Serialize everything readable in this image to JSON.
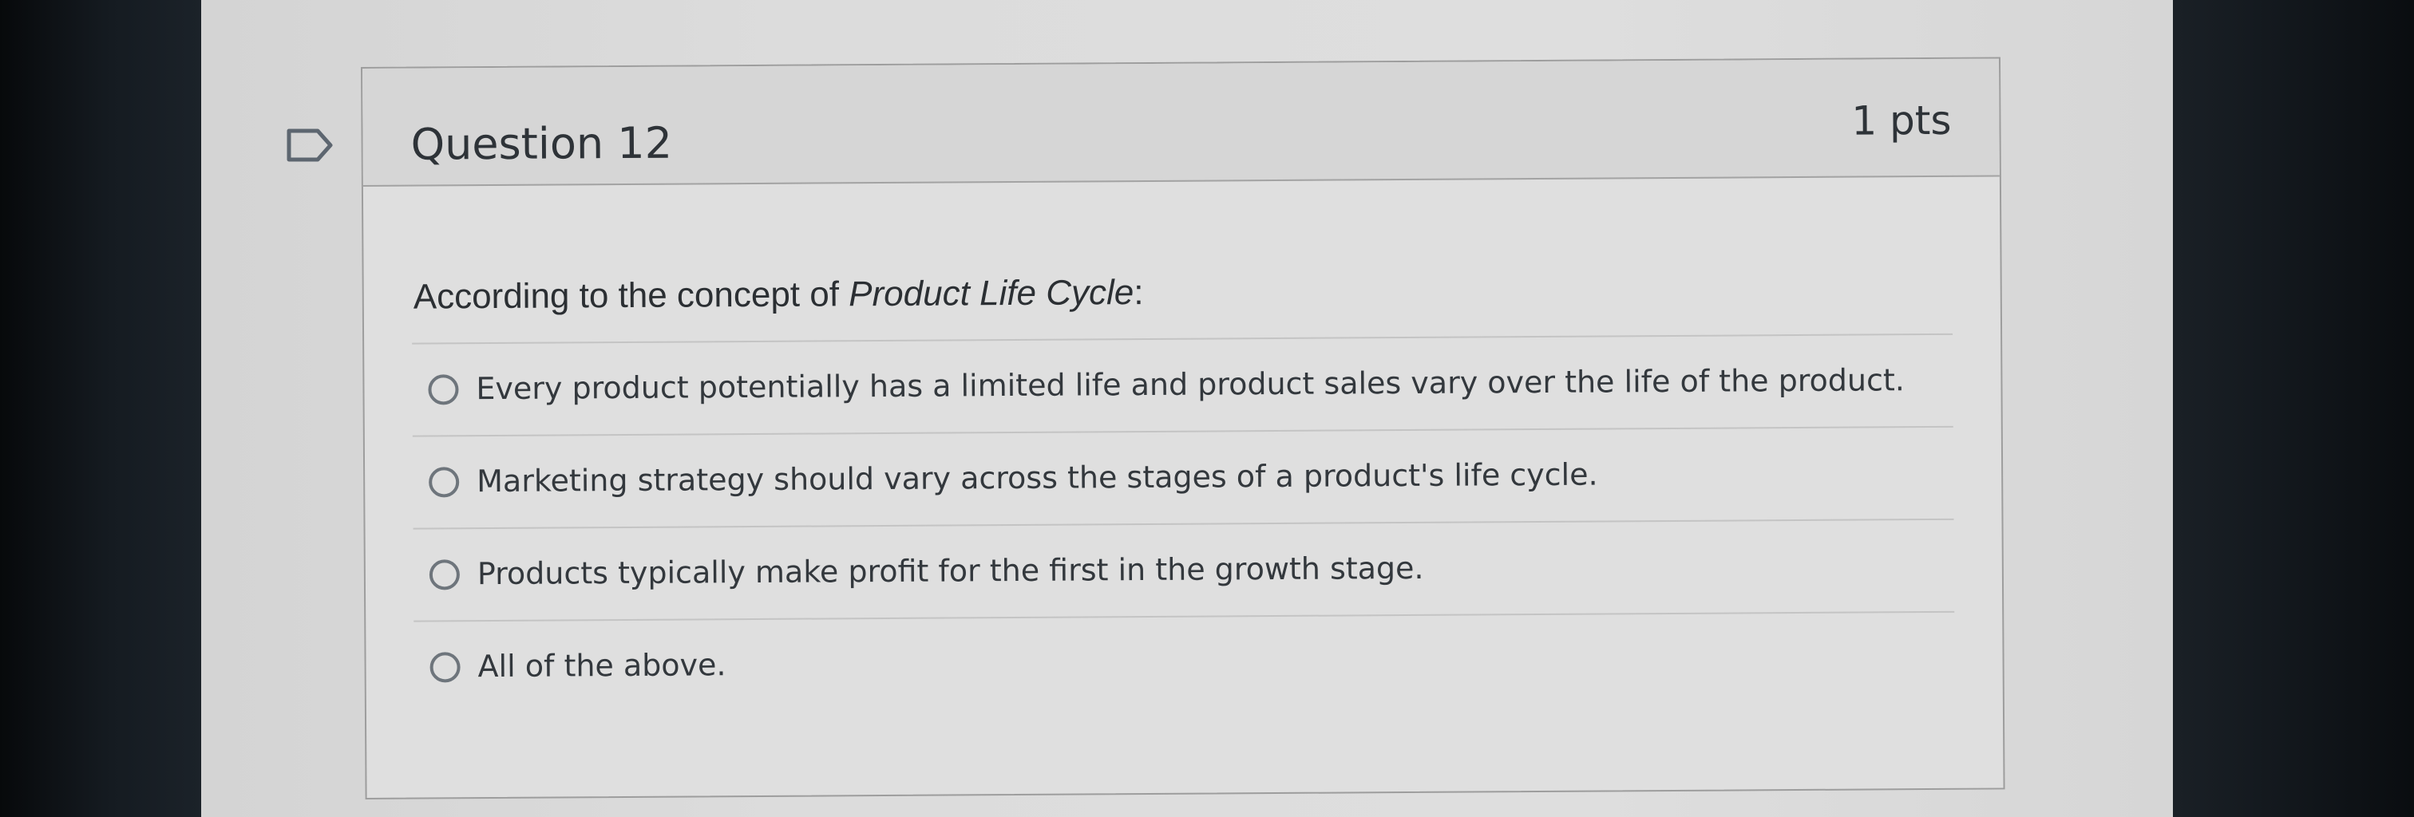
{
  "question": {
    "title": "Question 12",
    "points": "1 pts",
    "flag_icon": "flag-icon",
    "prompt_prefix": "According to the concept of ",
    "prompt_emphasis": "Product Life Cycle",
    "prompt_suffix": ":"
  },
  "answers": [
    {
      "label": "Every product potentially has a limited life and product sales vary over the life of the product.",
      "selected": false
    },
    {
      "label": "Marketing strategy should vary across the stages of a product's life cycle.",
      "selected": false
    },
    {
      "label": "Products typically make profit for the first in the growth stage.",
      "selected": false
    },
    {
      "label": "All of the above.",
      "selected": false
    }
  ]
}
